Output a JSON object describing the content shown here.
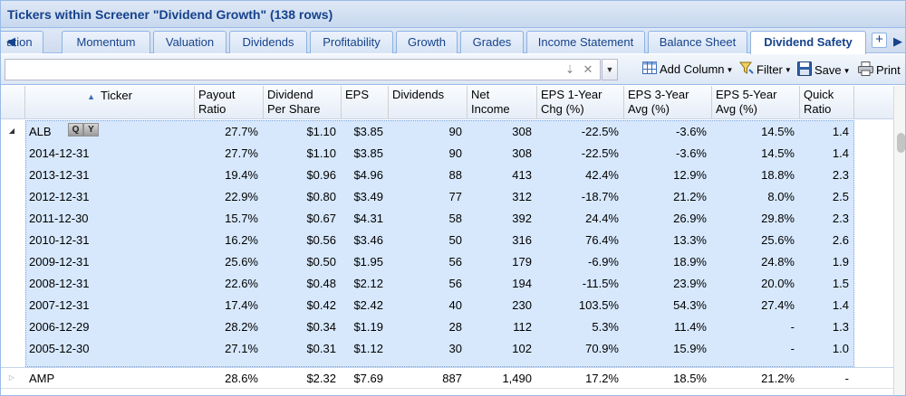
{
  "window": {
    "title": "Tickers within Screener \"Dividend Growth\" (138 rows)"
  },
  "tabs": [
    {
      "label": "ation"
    },
    {
      "label": "Momentum"
    },
    {
      "label": "Valuation"
    },
    {
      "label": "Dividends"
    },
    {
      "label": "Profitability"
    },
    {
      "label": "Growth"
    },
    {
      "label": "Grades"
    },
    {
      "label": "Income Statement"
    },
    {
      "label": "Balance Sheet"
    },
    {
      "label": "Dividend Safety"
    }
  ],
  "active_tab": "Dividend Safety",
  "toolbar": {
    "search_value": "",
    "add_column": "Add Column",
    "filter": "Filter",
    "save": "Save",
    "print": "Print"
  },
  "headers": {
    "ticker": "Ticker",
    "payout": [
      "Payout",
      "Ratio"
    ],
    "dps": [
      "Dividend",
      "Per Share"
    ],
    "eps": "EPS",
    "dividends": "Dividends",
    "net_income": [
      "Net",
      "Income"
    ],
    "eps1": [
      "EPS 1-Year",
      "Chg (%)"
    ],
    "eps3": [
      "EPS 3-Year",
      "Avg (%)"
    ],
    "eps5": [
      "EPS 5-Year",
      "Avg (%)"
    ],
    "quick": [
      "Quick",
      "Ratio"
    ]
  },
  "group": {
    "ticker": "ALB",
    "buttons": [
      "Q",
      "Y"
    ],
    "values": [
      "27.7%",
      "$1.10",
      "$3.85",
      "90",
      "308",
      "-22.5%",
      "-3.6%",
      "14.5%",
      "1.4"
    ]
  },
  "rows": [
    [
      "2014-12-31",
      "27.7%",
      "$1.10",
      "$3.85",
      "90",
      "308",
      "-22.5%",
      "-3.6%",
      "14.5%",
      "1.4"
    ],
    [
      "2013-12-31",
      "19.4%",
      "$0.96",
      "$4.96",
      "88",
      "413",
      "42.4%",
      "12.9%",
      "18.8%",
      "2.3"
    ],
    [
      "2012-12-31",
      "22.9%",
      "$0.80",
      "$3.49",
      "77",
      "312",
      "-18.7%",
      "21.2%",
      "8.0%",
      "2.5"
    ],
    [
      "2011-12-30",
      "15.7%",
      "$0.67",
      "$4.31",
      "58",
      "392",
      "24.4%",
      "26.9%",
      "29.8%",
      "2.3"
    ],
    [
      "2010-12-31",
      "16.2%",
      "$0.56",
      "$3.46",
      "50",
      "316",
      "76.4%",
      "13.3%",
      "25.6%",
      "2.6"
    ],
    [
      "2009-12-31",
      "25.6%",
      "$0.50",
      "$1.95",
      "56",
      "179",
      "-6.9%",
      "18.9%",
      "24.8%",
      "1.9"
    ],
    [
      "2008-12-31",
      "22.6%",
      "$0.48",
      "$2.12",
      "56",
      "194",
      "-11.5%",
      "23.9%",
      "20.0%",
      "1.5"
    ],
    [
      "2007-12-31",
      "17.4%",
      "$0.42",
      "$2.42",
      "40",
      "230",
      "103.5%",
      "54.3%",
      "27.4%",
      "1.4"
    ],
    [
      "2006-12-29",
      "28.2%",
      "$0.34",
      "$1.19",
      "28",
      "112",
      "5.3%",
      "11.4%",
      "-",
      "1.3"
    ],
    [
      "2005-12-30",
      "27.1%",
      "$0.31",
      "$1.12",
      "30",
      "102",
      "70.9%",
      "15.9%",
      "-",
      "1.0"
    ]
  ],
  "next_group": {
    "ticker": "AMP",
    "values": [
      "28.6%",
      "$2.32",
      "$7.69",
      "887",
      "1,490",
      "17.2%",
      "18.5%",
      "21.2%",
      "-"
    ]
  },
  "colors": {
    "title": "#15428b",
    "header_bg": "#dfe8f6",
    "selection": "#d7e8fd",
    "border": "#99bbe8"
  },
  "icons": [
    "scroll-left-icon",
    "add-tab-icon",
    "sort-asc-icon",
    "expand-icon",
    "collapse-icon",
    "clear-icon",
    "dropdown-icon",
    "grid-icon",
    "filter-icon",
    "save-icon",
    "printer-icon"
  ]
}
